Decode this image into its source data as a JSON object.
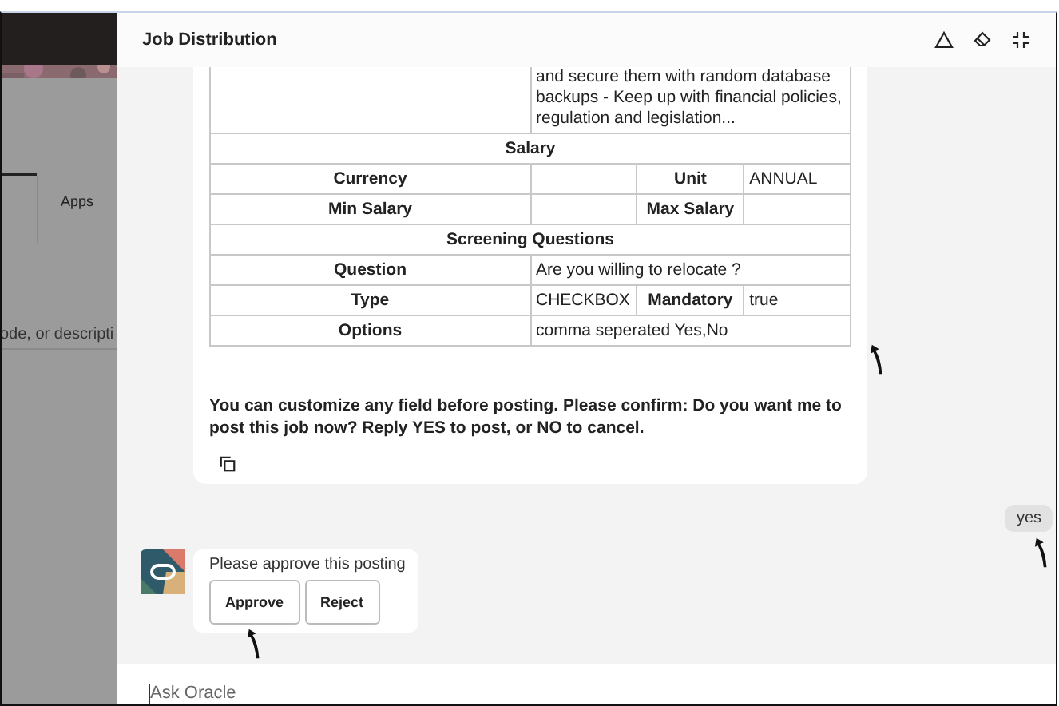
{
  "background": {
    "tab_label": "Apps",
    "search_placeholder": "ode, or descripti"
  },
  "panel": {
    "title": "Job Distribution"
  },
  "table": {
    "rows": [
      {
        "kind": "text",
        "value": "and secure them with random database backups - Keep up with financial policies, regulation and legislation..."
      },
      {
        "kind": "header",
        "label": "Salary"
      },
      {
        "kind": "quad",
        "label": "Currency",
        "label_2": "Unit",
        "value_2": "ANNUAL"
      },
      {
        "kind": "quad",
        "label": "Min Salary",
        "label_2": "Max Salary"
      },
      {
        "kind": "header",
        "label": "Screening Questions"
      },
      {
        "kind": "pair",
        "label": "Question",
        "value": "Are you willing to relocate ?"
      },
      {
        "kind": "quad",
        "label": "Type",
        "value": "CHECKBOX",
        "label_2": "Mandatory",
        "value_2": "true"
      },
      {
        "kind": "pair",
        "label": "Options",
        "value": "comma seperated Yes,No"
      }
    ]
  },
  "bot_message": "You can customize any field before posting. Please confirm: Do you want me to post this job now? Reply YES to post, or NO to cancel.",
  "user_message": "yes",
  "approval": {
    "prompt": "Please approve this posting",
    "buttons": [
      "Approve",
      "Reject"
    ]
  },
  "input": {
    "placeholder": "Ask Oracle"
  }
}
